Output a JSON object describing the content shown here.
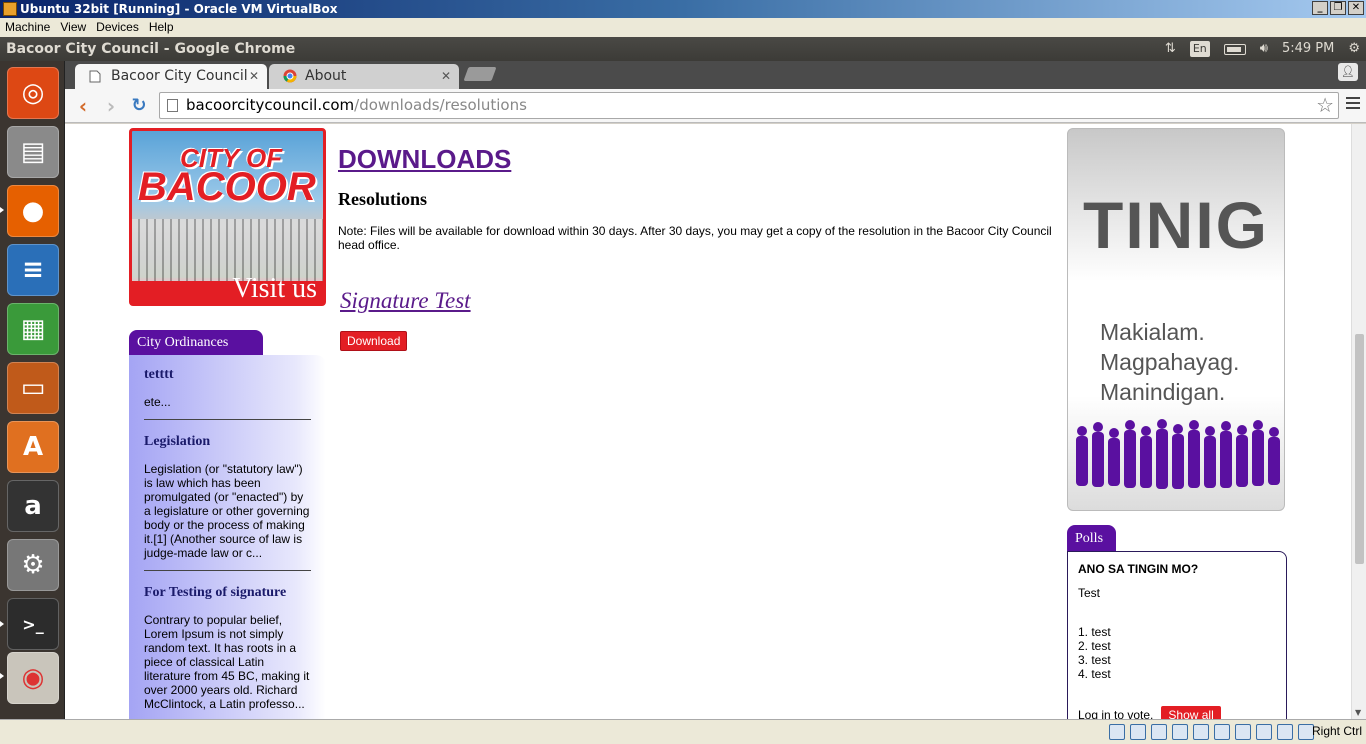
{
  "vbox": {
    "title": "Ubuntu 32bit [Running] - Oracle VM VirtualBox",
    "menu": [
      "Machine",
      "View",
      "Devices",
      "Help"
    ],
    "host_key": "Right Ctrl"
  },
  "ubuntu_panel": {
    "window_title": "Bacoor City Council - Google Chrome",
    "keyboard": "En",
    "clock": "5:49 PM"
  },
  "launcher": {
    "items": [
      "ubuntu-dash",
      "files",
      "firefox",
      "libreoffice-writer",
      "libreoffice-calc",
      "libreoffice-impress",
      "ubuntu-software-center",
      "amazon",
      "system-settings",
      "terminal",
      "chrome"
    ]
  },
  "chrome": {
    "tabs": [
      {
        "label": "Bacoor City Council",
        "active": true
      },
      {
        "label": "About",
        "active": false
      }
    ],
    "url_host": "bacoorcitycouncil.com",
    "url_path": "/downloads/resolutions"
  },
  "page": {
    "banner": {
      "line1": "CITY OF",
      "line2": "BACOOR",
      "cta": "Visit us"
    },
    "downloads_heading": "DOWNLOADS",
    "section_heading": "Resolutions",
    "note": "Note: Files will be available for download within 30 days. After 30 days, you may get a copy of the resolution in the Bacoor City Council head office.",
    "item_title": "Signature Test",
    "download_label": "Download",
    "ordinances": {
      "tab_label": "City Ordinances",
      "items": [
        {
          "title": "tetttt",
          "excerpt": "ete..."
        },
        {
          "title": "Legislation",
          "excerpt": "Legislation (or \"statutory law\") is law which has been promulgated (or \"enacted\") by a legislature or other governing body or the process of making it.[1] (Another source of law is judge-made law or c..."
        },
        {
          "title": "For Testing of signature",
          "excerpt": "Contrary to popular belief, Lorem Ipsum is not simply random text. It has roots in a piece of classical Latin literature from 45 BC, making it over 2000 years old. Richard McClintock, a Latin professo..."
        }
      ]
    },
    "ad": {
      "brand": "TINIG",
      "slogan": [
        "Makialam.",
        "Magpahayag.",
        "Manindigan."
      ]
    },
    "polls": {
      "tab_label": "Polls",
      "question": "ANO SA TINGIN MO?",
      "description": "Test",
      "options": [
        "1. test",
        "2. test",
        "3. test",
        "4. test"
      ],
      "login_text": "Log in to vote.",
      "show_all_label": "Show all"
    }
  },
  "colors": {
    "accent_purple": "#5a10a0",
    "link_purple": "#5a1a8a",
    "button_red": "#e31e24"
  }
}
